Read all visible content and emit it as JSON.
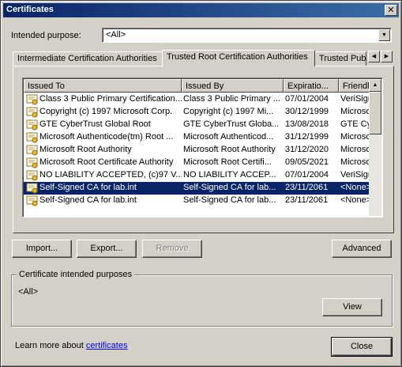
{
  "window": {
    "title": "Certificates",
    "close_symbol": "✕"
  },
  "purpose": {
    "label": "Intended purpose:",
    "value": "<All>"
  },
  "tabs": [
    {
      "label": "Intermediate Certification Authorities"
    },
    {
      "label": "Trusted Root Certification Authorities"
    },
    {
      "label": "Trusted Publ"
    }
  ],
  "columns": [
    "Issued To",
    "Issued By",
    "Expiratio...",
    "Friendl"
  ],
  "rows": [
    {
      "issued_to": "Class 3 Public Primary Certification...",
      "issued_by": "Class 3 Public Primary ...",
      "expiration": "07/01/2004",
      "friendly": "VeriSign"
    },
    {
      "issued_to": "Copyright (c) 1997 Microsoft Corp.",
      "issued_by": "Copyright (c) 1997 Mi...",
      "expiration": "30/12/1999",
      "friendly": "Microsof"
    },
    {
      "issued_to": "GTE CyberTrust Global Root",
      "issued_by": "GTE CyberTrust Globa...",
      "expiration": "13/08/2018",
      "friendly": "GTE Cy"
    },
    {
      "issued_to": "Microsoft Authenticode(tm) Root ...",
      "issued_by": "Microsoft Authenticod...",
      "expiration": "31/12/1999",
      "friendly": "Microsof"
    },
    {
      "issued_to": "Microsoft Root Authority",
      "issued_by": "Microsoft Root Authority",
      "expiration": "31/12/2020",
      "friendly": "Microsof"
    },
    {
      "issued_to": "Microsoft Root Certificate Authority",
      "issued_by": "Microsoft Root Certifi...",
      "expiration": "09/05/2021",
      "friendly": "Microsof"
    },
    {
      "issued_to": "NO LIABILITY ACCEPTED, (c)97 V...",
      "issued_by": "NO LIABILITY ACCEP...",
      "expiration": "07/01/2004",
      "friendly": "VeriSign"
    },
    {
      "issued_to": "Self-Signed CA for lab.int",
      "issued_by": "Self-Signed CA for lab...",
      "expiration": "23/11/2061",
      "friendly": "<None>"
    },
    {
      "issued_to": "Self-Signed CA for lab.int",
      "issued_by": "Self-Signed CA for lab...",
      "expiration": "23/11/2061",
      "friendly": "<None>"
    }
  ],
  "buttons": {
    "import": "Import...",
    "export": "Export...",
    "remove": "Remove",
    "advanced": "Advanced",
    "view": "View",
    "close": "Close"
  },
  "group": {
    "title": "Certificate intended purposes",
    "value": "<All>"
  },
  "footer": {
    "prefix": "Learn more about ",
    "link": "certificates"
  },
  "colors": {
    "selection": "#0a246a",
    "face": "#d4d0c8",
    "link": "#0000ff"
  }
}
